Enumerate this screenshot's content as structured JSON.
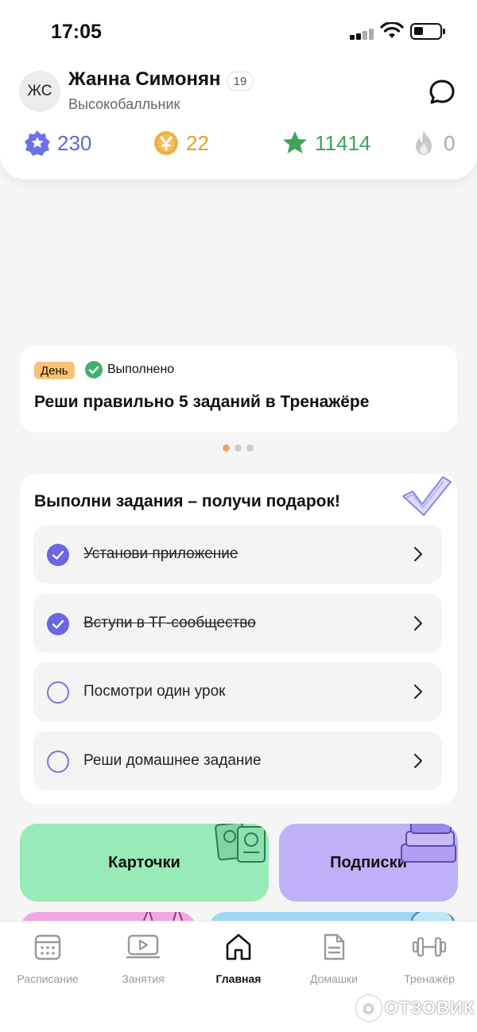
{
  "status_bar": {
    "time": "17:05"
  },
  "profile": {
    "initials": "ЖС",
    "name": "Жанна Симонян",
    "level": "19",
    "rank": "Высокобалльник"
  },
  "stats": [
    {
      "icon": "rating-badge-icon",
      "value": "230",
      "color": "#5b6ad9"
    },
    {
      "icon": "coin-icon",
      "value": "22",
      "color": "#e0a12e"
    },
    {
      "icon": "star-icon",
      "value": "11414",
      "color": "#3fa35a"
    },
    {
      "icon": "flame-icon",
      "value": "0",
      "color": "#aaaaaa"
    }
  ],
  "daily_task": {
    "badge": "День",
    "status": "Выполнено",
    "title": "Реши правильно 5 заданий в Тренажёре"
  },
  "tasks": {
    "title": "Выполни задания – получи подарок!",
    "items": [
      {
        "label": "Установи приложение",
        "done": true
      },
      {
        "label": "Вступи в ТГ-сообщество",
        "done": true
      },
      {
        "label": "Посмотри один урок",
        "done": false
      },
      {
        "label": "Реши домашнее задание",
        "done": false
      }
    ]
  },
  "tiles": {
    "cards": "Карточки",
    "subscriptions": "Подписки"
  },
  "nav": {
    "items": [
      {
        "label": "Расписание",
        "icon": "calendar-icon"
      },
      {
        "label": "Занятия",
        "icon": "video-lesson-icon"
      },
      {
        "label": "Главная",
        "icon": "home-icon",
        "active": true
      },
      {
        "label": "Домашки",
        "icon": "document-icon"
      },
      {
        "label": "Тренажёр",
        "icon": "dumbbell-icon"
      }
    ]
  },
  "watermark": {
    "text": "ОТЗОВИК"
  },
  "colors": {
    "accent": "#6b67e0",
    "badge_day": "#f9c375",
    "done_green": "#3fb26a",
    "tile_green": "#98eab8",
    "tile_purple": "#c0b0f8",
    "tile_pink": "#f2a5e6",
    "tile_blue": "#9fd8f4"
  }
}
